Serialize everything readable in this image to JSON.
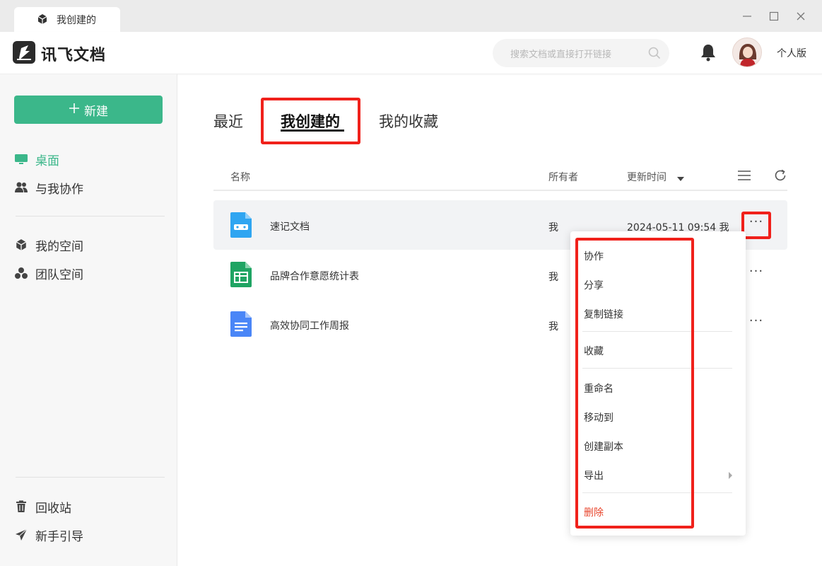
{
  "window": {
    "tab_title": "我创建的",
    "min_label": "—",
    "max_label": "☐",
    "close_label": "✕"
  },
  "header": {
    "brand": "讯飞文档",
    "search_placeholder": "搜索文档或直接打开链接",
    "edition": "个人版"
  },
  "sidebar": {
    "new_label": "新建",
    "items": [
      {
        "label": "桌面",
        "icon": "monitor-icon"
      },
      {
        "label": "与我协作",
        "icon": "people-icon"
      },
      {
        "label": "我的空间",
        "icon": "cube-icon"
      },
      {
        "label": "团队空间",
        "icon": "team-icon"
      },
      {
        "label": "回收站",
        "icon": "trash-icon"
      },
      {
        "label": "新手引导",
        "icon": "paper-plane-icon"
      }
    ]
  },
  "main": {
    "tabs": [
      "最近",
      "我创建的",
      "我的收藏"
    ],
    "active_tab": "我创建的",
    "columns": {
      "name": "名称",
      "owner": "所有者",
      "updated": "更新时间"
    },
    "rows": [
      {
        "name": "速记文档",
        "owner": "我",
        "updated": "2024-05-11 09:54 我",
        "icon": "shorthand-doc-icon"
      },
      {
        "name": "品牌合作意愿统计表",
        "owner": "我",
        "updated": "",
        "icon": "spreadsheet-icon"
      },
      {
        "name": "高效协同工作周报",
        "owner": "我",
        "updated": "",
        "icon": "document-icon"
      }
    ],
    "more_label": "···"
  },
  "context_menu": {
    "items": [
      "协作",
      "分享",
      "复制链接",
      "收藏",
      "重命名",
      "移动到",
      "创建副本",
      "导出",
      "删除"
    ]
  },
  "colors": {
    "accent": "#3bb78a",
    "highlight": "#f0211b",
    "danger": "#e8452c",
    "doc_blue": "#4a86f7",
    "sheet_green": "#1fa463",
    "shorthand_blue": "#2fa5f1"
  }
}
